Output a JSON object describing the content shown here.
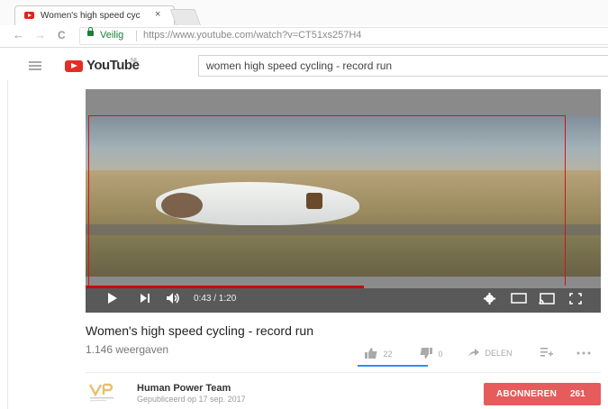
{
  "browser": {
    "tab_title": "Women's high speed cyc",
    "tab_close": "×",
    "nav_back": "←",
    "nav_forward": "→",
    "nav_reload": "C",
    "secure_label": "Veilig",
    "url": "https://www.youtube.com/watch?v=CT51xs257H4"
  },
  "youtube": {
    "logo_text": "YouTube",
    "region": "NL",
    "search_value": "women high speed cycling - record run"
  },
  "player": {
    "current_time": "0:43",
    "duration": "1:20",
    "time_display": "0:43 / 1:20",
    "progress_fraction": 0.54
  },
  "video": {
    "title": "Women's high speed cycling - record run",
    "views": "1.146 weergaven",
    "likes": "22",
    "dislikes": "0",
    "share_label": "DELEN"
  },
  "channel": {
    "name": "Human Power Team",
    "published": "Gepubliceerd op 17 sep. 2017",
    "subscribe_label": "ABONNEREN",
    "subscriber_count": "261"
  },
  "colors": {
    "youtube_red": "#e52d27",
    "subscribe_bg": "#e65c5c",
    "secure_green": "#1a7f37",
    "like_underline": "#2f8cff"
  }
}
